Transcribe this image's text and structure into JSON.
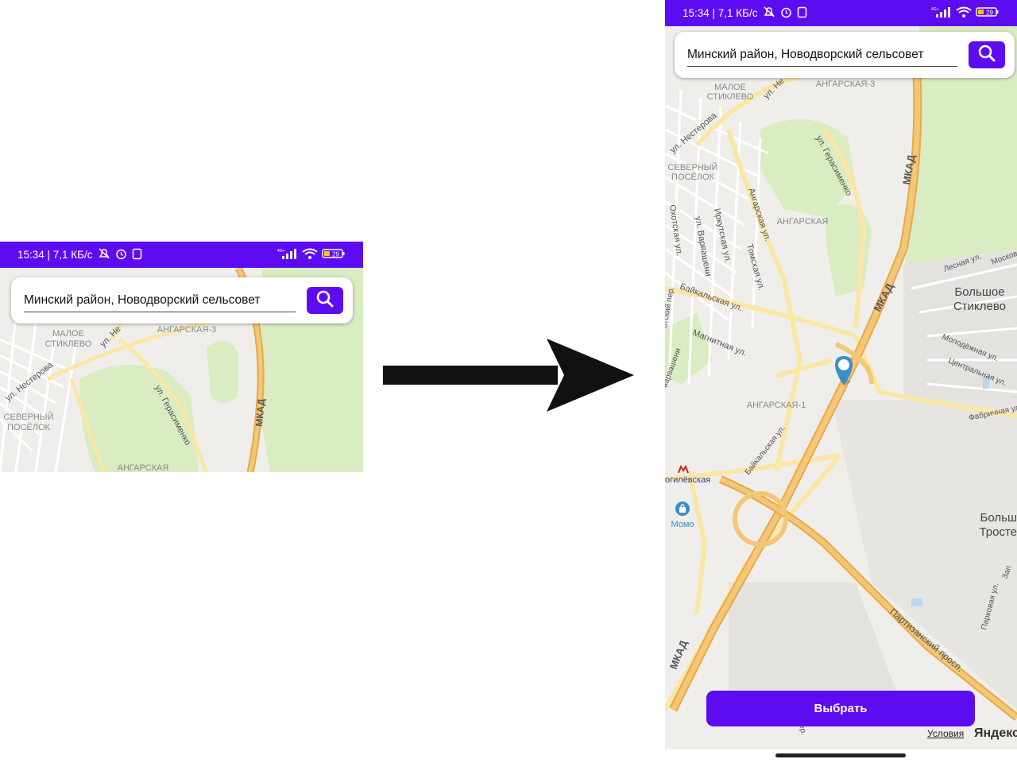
{
  "status_bar": {
    "time_speed": "15:34 | 7,1 КБ/с",
    "network_label": "4G+",
    "battery": "29"
  },
  "search": {
    "value": "Минский район, Новодворский сельсовет"
  },
  "map_labels": {
    "maloe_stiklevo": [
      "МАЛОЕ",
      "СТИКЛЕВО"
    ],
    "angarskaya3": "АНГАРСКАЯ-3",
    "ul_nesterova": "ул. Нестерова",
    "ul_ne": "ул. Не",
    "severny_posyolok": [
      "СЕВЕРНЫЙ",
      "ПОСЁЛОК"
    ],
    "ul_gerasimenko": "ул. Герасименко",
    "mkad": "МКАД",
    "angarskaya": "АНГАРСКАЯ",
    "angarskaya_ul": "Ангарская ул.",
    "irkutskaya": "Иркутская ул.",
    "ul_varvasheni": "ул. Варвашени",
    "tomskaya": "Томская ул.",
    "okhotskaya": "Охотская ул.",
    "baikalskaya": "Байкальская ул.",
    "magnitnaya": "Магнитная ул.",
    "lesnaya": "Лесная ул.",
    "moskovskaya": "Московс",
    "bolshoe_stiklevo": [
      "Большое",
      "Стиклево"
    ],
    "molodezhnaya": "Молодёжная ул.",
    "centralnaya": "Центральная ул.",
    "fabrichnaya": "Фабричная ул.",
    "angarskaya1": "АНГАРСКАЯ-1",
    "baikalskaya2": "Байкальская ул.",
    "mogilevskaya": "огилёвская",
    "momo": "Момо",
    "bolshoe_trost": [
      "Больш",
      "Тросте"
    ],
    "partizansky": "Партизанский просп.",
    "parkovaya": "Парковая ул.",
    "zap": "Зап",
    "varvasheni2": "варвашени",
    "ohotsky_per": "отский пер.",
    "ul_per": "ул пер."
  },
  "select_button": "Выбрать",
  "terms_link": "Условия",
  "yandex_logo": "Яндекс",
  "colors": {
    "accent": "#5d0cf2",
    "map_bg": "#efeeea",
    "forest": "#d9ecc2",
    "road_major": "#f0c46a",
    "road_minor": "#fbe7a5",
    "pin": "#3a8fc4"
  }
}
